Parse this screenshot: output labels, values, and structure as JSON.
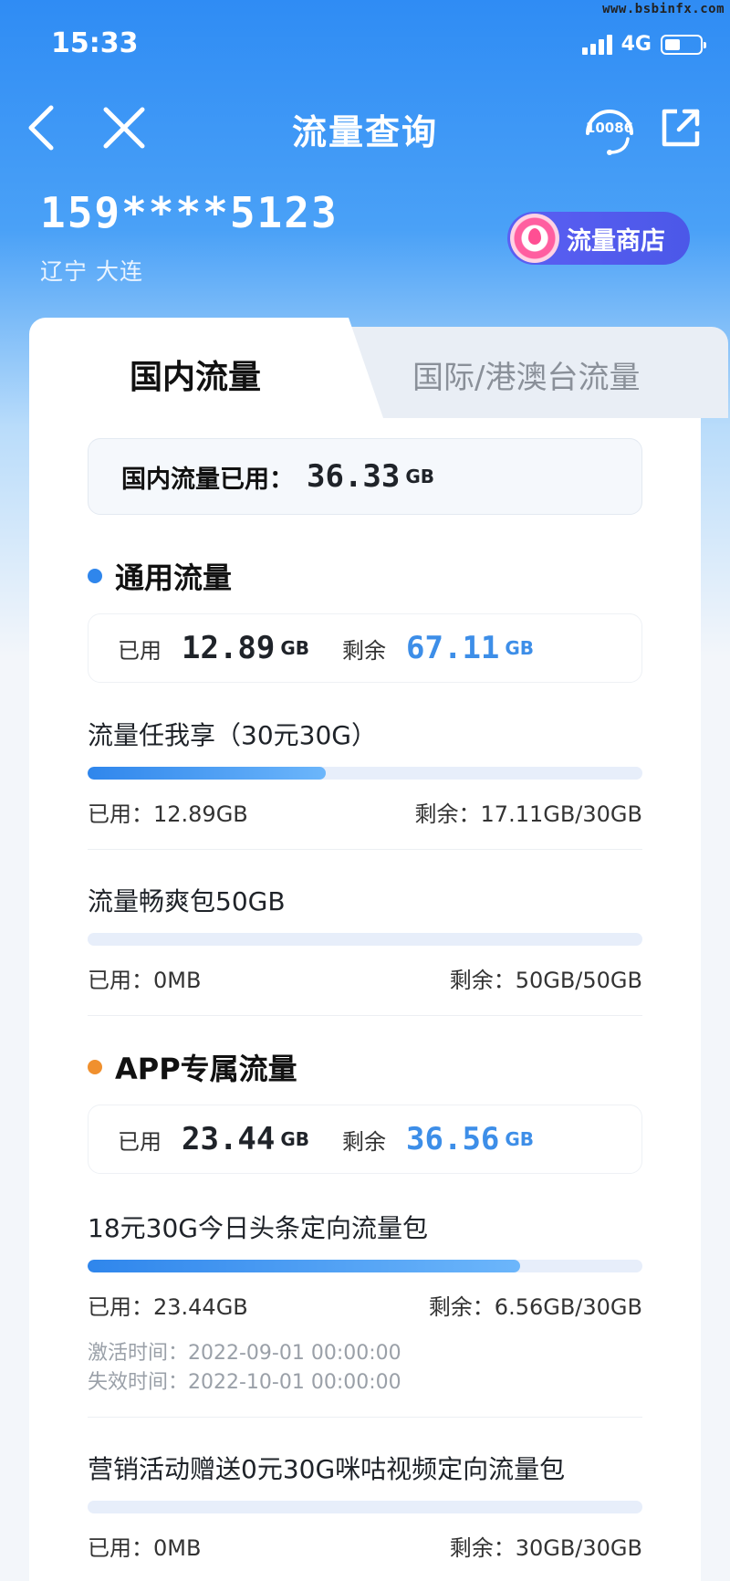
{
  "watermark": "www.bsbinfx.com",
  "status": {
    "time": "15:33",
    "network": "4G"
  },
  "nav": {
    "title": "流量查询",
    "service_label": "10086"
  },
  "user": {
    "phone": "159****5123",
    "region": "辽宁 大连"
  },
  "shop": {
    "label": "流量商店"
  },
  "tabs": {
    "active": "国内流量",
    "inactive": "国际/港澳台流量"
  },
  "total": {
    "label": "国内流量已用：",
    "value": "36.33",
    "unit": "GB"
  },
  "general": {
    "title": "通用流量",
    "color": "#2f86ec",
    "used_label": "已用",
    "used_value": "12.89",
    "remain_label": "剩余",
    "remain_value": "67.11",
    "unit": "GB",
    "packages": [
      {
        "name": "流量任我享（30元30G）",
        "used": "已用：12.89GB",
        "remain": "剩余：17.11GB/30GB",
        "progress": 0.43
      },
      {
        "name": "流量畅爽包50GB",
        "used": "已用：0MB",
        "remain": "剩余：50GB/50GB",
        "progress": 0
      }
    ]
  },
  "app": {
    "title": "APP专属流量",
    "color": "#f0902e",
    "used_label": "已用",
    "used_value": "23.44",
    "remain_label": "剩余",
    "remain_value": "36.56",
    "unit": "GB",
    "packages": [
      {
        "name": "18元30G今日头条定向流量包",
        "used": "已用：23.44GB",
        "remain": "剩余：6.56GB/30GB",
        "progress": 0.78,
        "activate": "激活时间：2022-09-01 00:00:00",
        "expire": "失效时间：2022-10-01 00:00:00"
      },
      {
        "name": "营销活动赠送0元30G咪咕视频定向流量包",
        "used": "已用：0MB",
        "remain": "剩余：30GB/30GB",
        "progress": 0
      }
    ]
  }
}
